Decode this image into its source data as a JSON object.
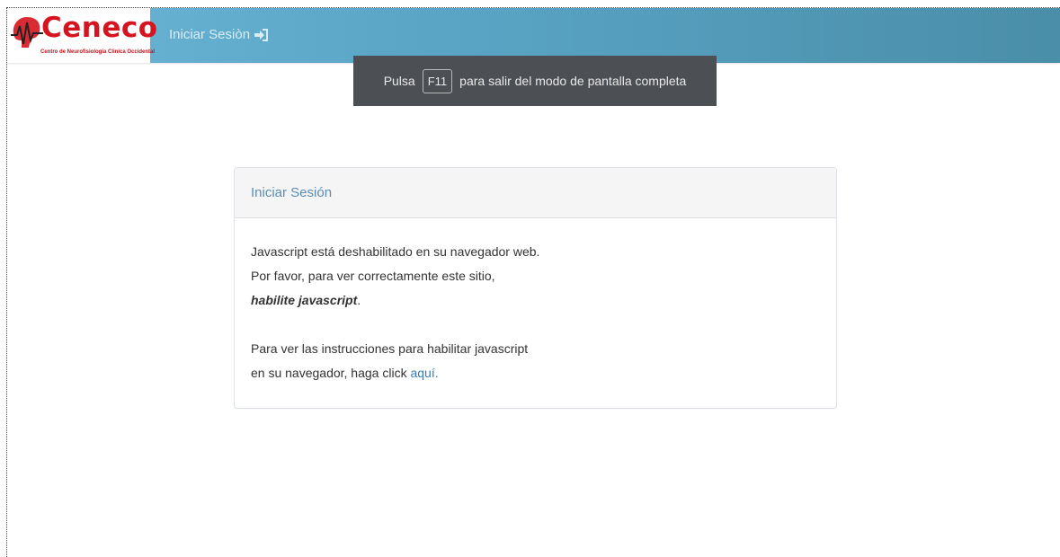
{
  "navbar": {
    "logo": {
      "name": "Ceneco",
      "subtitle": "Centro de Neurofisiologia Clinica Occidental"
    },
    "login_link": "Iniciar Sesiòn"
  },
  "fullscreen_banner": {
    "prefix": "Pulsa",
    "key": "F11",
    "suffix": "para salir del modo de pantalla completa"
  },
  "panel": {
    "title": "Iniciar Sesión",
    "line1": "Javascript está deshabilitado en su navegador web.",
    "line2": "Por favor, para ver correctamente este sitio,",
    "line3_emphasis": "habilite javascript",
    "line3_end": ".",
    "line4": "Para ver las instrucciones para habilitar javascript",
    "line5": "en su navegador, haga click",
    "link": "aquí."
  },
  "colors": {
    "navbar_start": "#6bb5d6",
    "navbar_end": "#4a8ea9",
    "brand_red": "#d6141f",
    "link_blue": "#3a7ab6",
    "banner_bg": "#4c4f53"
  },
  "icons": [
    "brain-ekg-icon",
    "sign-in-icon"
  ]
}
